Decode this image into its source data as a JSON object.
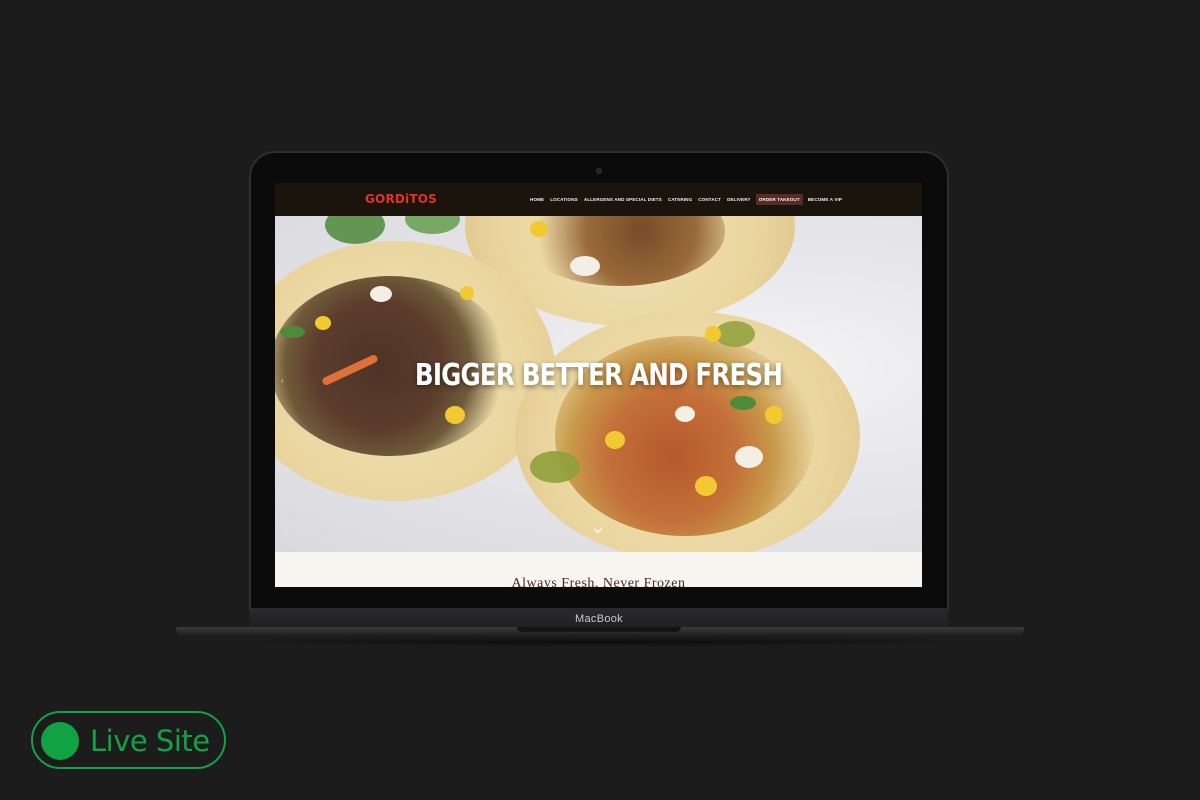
{
  "site": {
    "logo": "GORDiTOS",
    "nav": [
      {
        "label": "HOME"
      },
      {
        "label": "LOCATIONS"
      },
      {
        "label": "ALLERGENS AND SPECIAL DIETS"
      },
      {
        "label": "CATERING"
      },
      {
        "label": "CONTACT"
      },
      {
        "label": "DELIVERY"
      },
      {
        "label": "ORDER TAKEOUT"
      },
      {
        "label": "BECOME A VIP"
      }
    ],
    "hero_title": "BIGGER BETTER AND FRESH",
    "tagline": "Always Fresh, Never Frozen"
  },
  "device": {
    "label": "MacBook"
  },
  "badge": {
    "label": "Live Site",
    "color": "#11a343"
  },
  "colors": {
    "background": "#1c1c1c",
    "logo": "#e4312b",
    "nav_bg": "#1a140c",
    "cta_bg": "#5a2b24",
    "tagline": "#4a2a1c"
  }
}
